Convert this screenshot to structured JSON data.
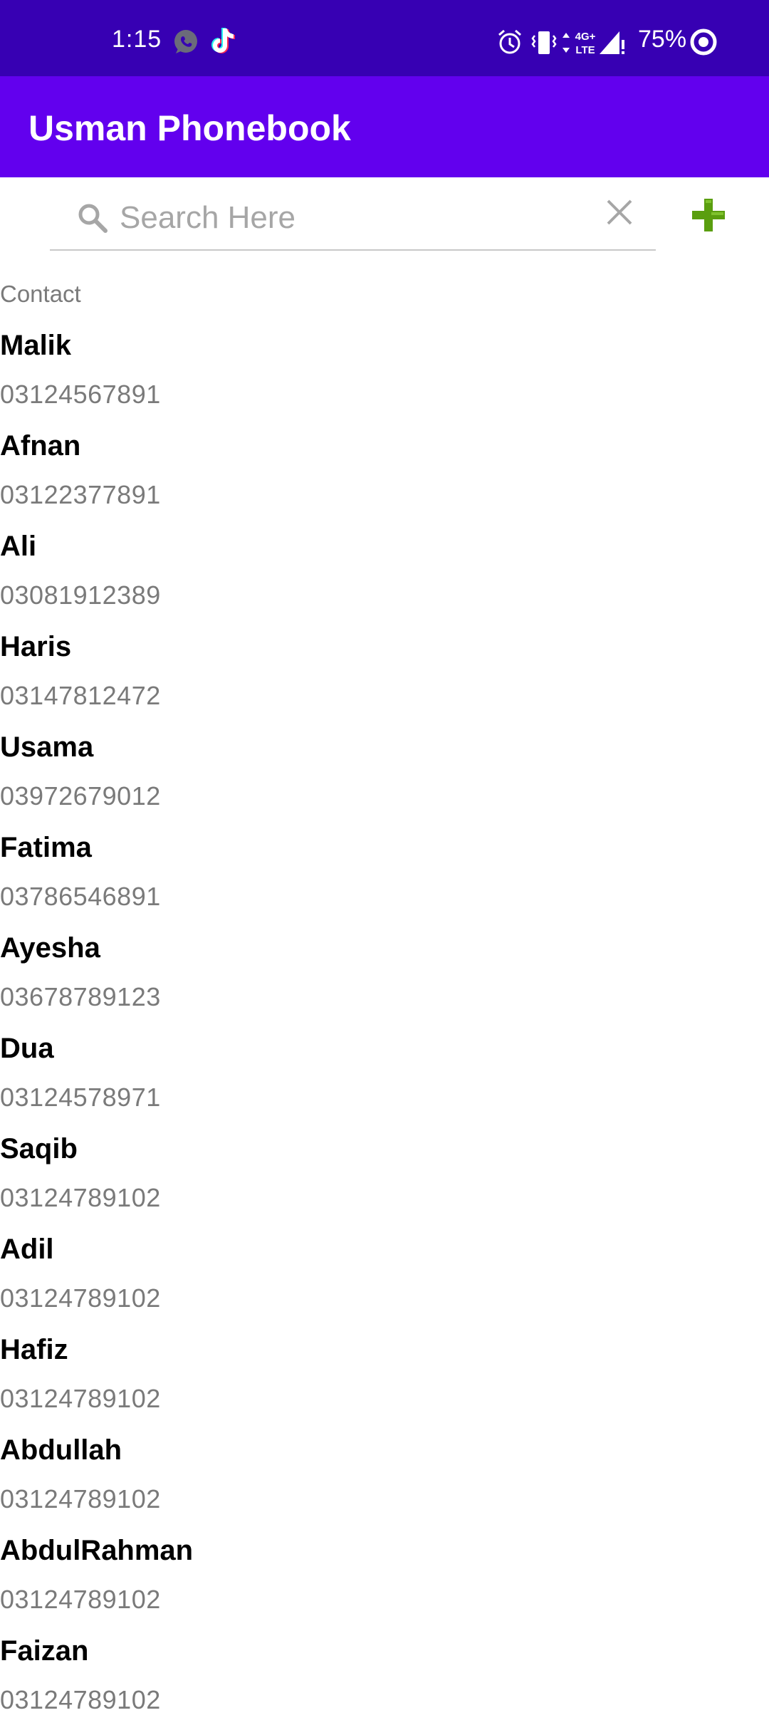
{
  "status_bar": {
    "time": "1:15",
    "network_label": "4G+ LTE",
    "battery": "75%"
  },
  "app_bar": {
    "title": "Usman Phonebook",
    "color": "#6200ee"
  },
  "search": {
    "placeholder": "Search Here",
    "value": ""
  },
  "list": {
    "section_label": "Contact",
    "contacts": [
      {
        "name": "Malik",
        "phone": "03124567891"
      },
      {
        "name": "Afnan",
        "phone": "03122377891"
      },
      {
        "name": "Ali",
        "phone": "03081912389"
      },
      {
        "name": "Haris",
        "phone": "03147812472"
      },
      {
        "name": "Usama",
        "phone": "03972679012"
      },
      {
        "name": "Fatima",
        "phone": "03786546891"
      },
      {
        "name": "Ayesha",
        "phone": "03678789123"
      },
      {
        "name": "Dua",
        "phone": "03124578971"
      },
      {
        "name": "Saqib",
        "phone": "03124789102"
      },
      {
        "name": "Adil",
        "phone": "03124789102"
      },
      {
        "name": "Hafiz",
        "phone": "03124789102"
      },
      {
        "name": "Abdullah",
        "phone": "03124789102"
      },
      {
        "name": "AbdulRahman",
        "phone": "03124789102"
      },
      {
        "name": "Faizan",
        "phone": "03124789102"
      }
    ]
  },
  "icons": {
    "whatsapp": "whatsapp-icon",
    "tiktok": "tiktok-icon",
    "alarm": "alarm-icon",
    "vibrate": "vibrate-icon",
    "signal": "signal-icon",
    "battery": "battery-ring-icon",
    "search": "search-icon",
    "close": "close-icon",
    "add": "add-icon"
  },
  "colors": {
    "status_bar": "#3700b3",
    "app_bar": "#6200ee",
    "add_icon": "#5a9e0f"
  }
}
